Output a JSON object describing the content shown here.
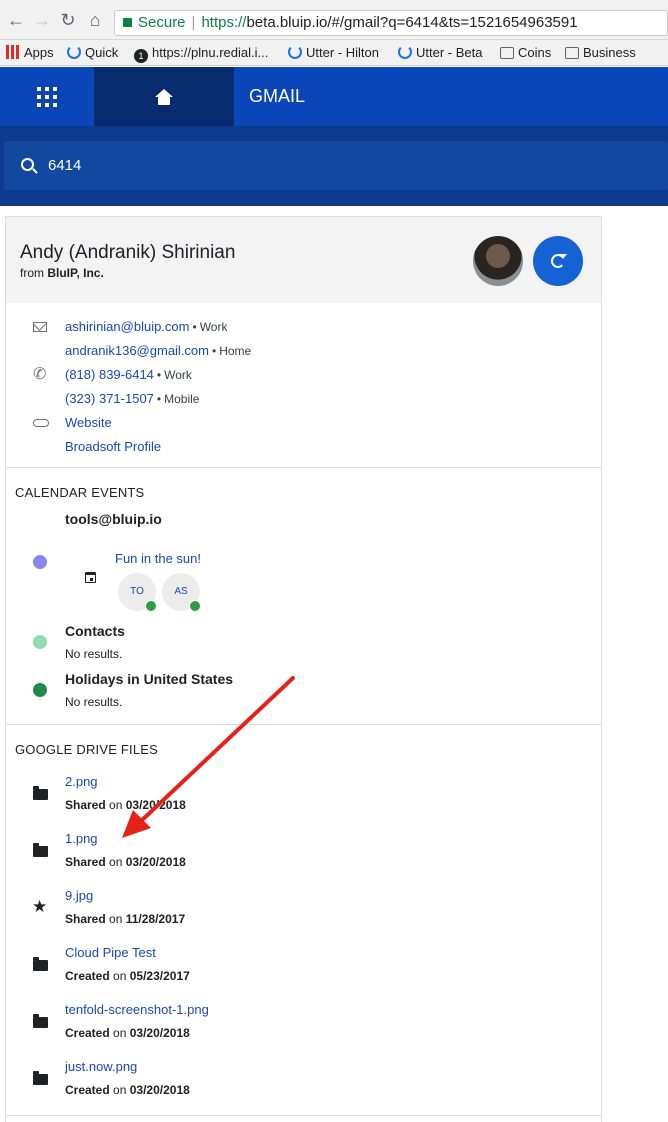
{
  "browser": {
    "secure_label": "Secure",
    "url_scheme": "https://",
    "url_rest": "beta.bluip.io/#/gmail?q=6414&ts=1521654963591",
    "bookmarks": [
      "Apps",
      "Quick",
      "https://plnu.redial.i...",
      "Utter - Hilton",
      "Utter - Beta",
      "Coins",
      "Business"
    ]
  },
  "header": {
    "title": "GMAIL"
  },
  "search": {
    "value": "6414"
  },
  "contact": {
    "name": "Andy (Andranik) Shirinian",
    "org_prefix": "from",
    "org": "BluIP, Inc.",
    "emails": [
      {
        "address": "ashirinian@bluip.com",
        "label": "Work"
      },
      {
        "address": "andranik136@gmail.com",
        "label": "Home"
      }
    ],
    "phones": [
      {
        "number": "(818) 839-6414",
        "label": "Work"
      },
      {
        "number": "(323) 371-1507",
        "label": "Mobile"
      }
    ],
    "links": [
      "Website",
      "Broadsoft Profile"
    ]
  },
  "calendar": {
    "section_title": "CALENDAR EVENTS",
    "calendars": [
      {
        "name": "tools@bluip.io",
        "color": "#8c86f0"
      },
      {
        "name": "Contacts",
        "empty": "No results.",
        "color": "#8fdcb1"
      },
      {
        "name": "Holidays in United States",
        "empty": "No results.",
        "color": "#1f8a4c"
      }
    ],
    "event": {
      "title": "Fun in the sun!",
      "attendees": [
        "TO",
        "AS"
      ]
    }
  },
  "drive": {
    "section_title": "GOOGLE DRIVE FILES",
    "files": [
      {
        "name": "2.png",
        "action": "Shared",
        "on": "on",
        "date": "03/20/2018",
        "icon": "folder-icon"
      },
      {
        "name": "1.png",
        "action": "Shared",
        "on": "on",
        "date": "03/20/2018",
        "icon": "folder-icon"
      },
      {
        "name": "9.jpg",
        "action": "Shared",
        "on": "on",
        "date": "11/28/2017",
        "icon": "star-icon"
      },
      {
        "name": "Cloud Pipe Test",
        "action": "Created",
        "on": "on",
        "date": "05/23/2017",
        "icon": "folder-icon"
      },
      {
        "name": "tenfold-screenshot-1.png",
        "action": "Created",
        "on": "on",
        "date": "03/20/2018",
        "icon": "folder-icon"
      },
      {
        "name": "just.now.png",
        "action": "Created",
        "on": "on",
        "date": "03/20/2018",
        "icon": "folder-icon"
      }
    ]
  },
  "colors": {
    "header": "#0a46b8",
    "header_active": "#072c6e",
    "search_band": "#0d3a8a",
    "link": "#1a47b5",
    "accent_button": "#1561d6",
    "annotation_arrow": "#e8201a"
  }
}
